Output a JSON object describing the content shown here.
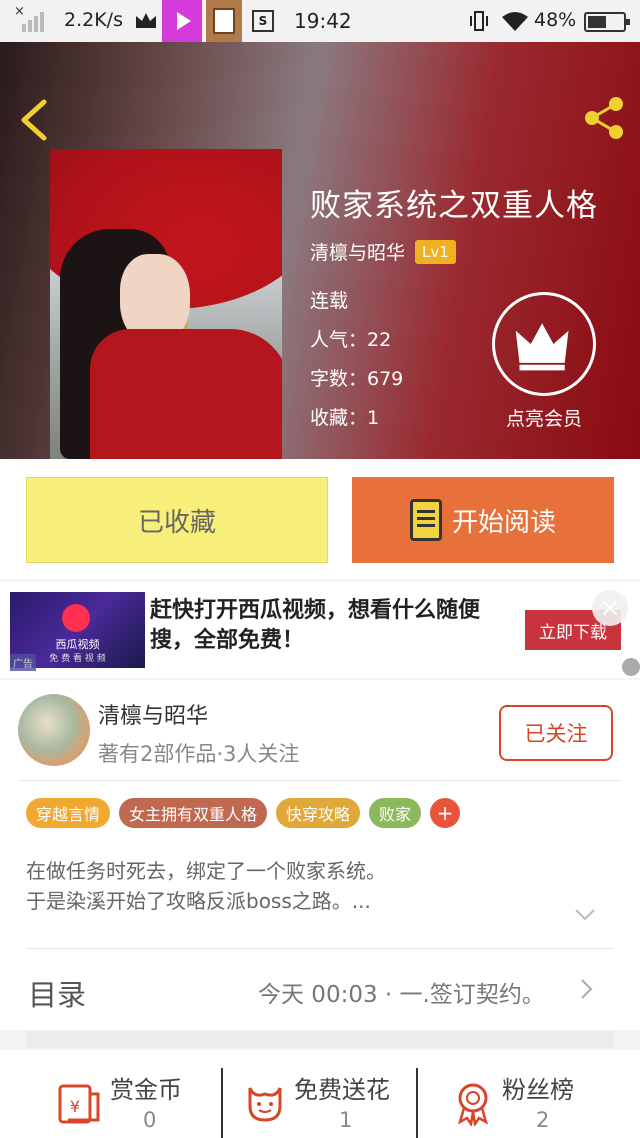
{
  "status_bar": {
    "speed": "2.2K/s",
    "time": "19:42",
    "battery": "48%",
    "icons": [
      "signal-x-icon",
      "crown-icon",
      "video-app-icon",
      "notebook-app-icon",
      "s-app-icon",
      "vibrate-icon",
      "wifi-icon",
      "battery-icon"
    ]
  },
  "book": {
    "title": "败家系统之双重人格",
    "author": "清檩与昭华",
    "level": "Lv1",
    "status": "连载",
    "popularity": "人气：22",
    "word_count": "字数：679",
    "favorites": "收藏：1",
    "vip_label": "点亮会员"
  },
  "actions": {
    "collected": "已收藏",
    "start_reading": "开始阅读"
  },
  "ad": {
    "brand": "西瓜视频",
    "brand_sub": "免 费 看 视 频",
    "tag": "广告",
    "text": "赶快打开西瓜视频，想看什么随便搜，全部免费！",
    "button": "立即下载"
  },
  "writer": {
    "name": "清檩与昭华",
    "stats": "著有2部作品·3人关注",
    "follow": "已关注"
  },
  "tags": [
    {
      "label": "穿越言情",
      "color": "#f0a830"
    },
    {
      "label": "女主拥有双重人格",
      "color": "#c06850"
    },
    {
      "label": "快穿攻略",
      "color": "#e0a838"
    },
    {
      "label": "败家",
      "color": "#8ab85a"
    }
  ],
  "tag_add": "+",
  "synopsis": {
    "line1": "在做任务时死去，绑定了一个败家系统。",
    "line2": "于是染溪开始了攻略反派boss之路。..."
  },
  "toc": {
    "label": "目录",
    "latest": "今天 00:03 · 一.签订契约。"
  },
  "bottom": {
    "reward_label": "赏金币",
    "reward_value": "0",
    "flower_label": "免费送花",
    "flower_value": "1",
    "fans_label": "粉丝榜",
    "fans_value": "2"
  },
  "colors": {
    "accent": "#e8703a",
    "collected_bg": "#f8ee7a",
    "follow": "#d8452a",
    "icon_red": "#d8452a"
  }
}
